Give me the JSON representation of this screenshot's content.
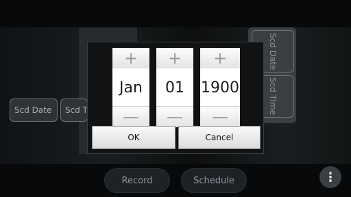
{
  "background": {
    "scd_date_label": "Scd Date",
    "scd_time_label": "Scd Time",
    "record_label": "Record",
    "schedule_label": "Schedule",
    "overflow_icon": "⋮"
  },
  "dialog": {
    "plus_symbol": "+",
    "minus_symbol": "—",
    "month": "Jan",
    "day": "01",
    "year": "1900",
    "ok_label": "OK",
    "cancel_label": "Cancel"
  }
}
